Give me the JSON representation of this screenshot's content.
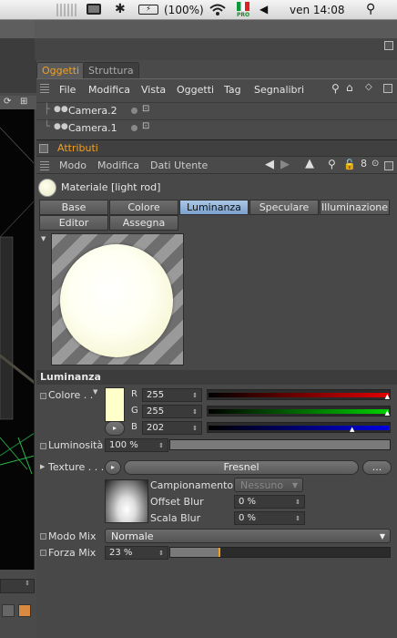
{
  "menubar": {
    "battery": "(100%)",
    "clock": "ven 14:08",
    "flag_label": "PRO"
  },
  "tabs": [
    {
      "label": "Oggetti",
      "active": true
    },
    {
      "label": "Struttura",
      "active": false
    }
  ],
  "object_manager": {
    "menu": [
      "File",
      "Modifica",
      "Vista",
      "Oggetti",
      "Tag",
      "Segnalibri"
    ],
    "objects": [
      "Camera.2",
      "Camera.1"
    ]
  },
  "attributes": {
    "title": "Attributi",
    "toolbar": [
      "Modo",
      "Modifica",
      "Dati Utente"
    ],
    "material_name": "Materiale [light rod]",
    "channel_tabs": [
      "Base",
      "Colore",
      "Luminanza",
      "Speculare",
      "Illuminazione",
      "Editor",
      "Assegna"
    ],
    "selected_channel": "Luminanza",
    "section_title": "Luminanza",
    "color": {
      "label": "Colore . .",
      "r_label": "R",
      "r": "255",
      "g_label": "G",
      "g": "255",
      "b_label": "B",
      "b": "202",
      "swatch": "#ffffca"
    },
    "brightness": {
      "label": "Luminosità",
      "value": "100 %",
      "fraction": 1.0
    },
    "texture": {
      "label": "Texture . . .",
      "shader": "Fresnel",
      "more": "...",
      "sampling_label": "Campionamento",
      "sampling_value": "Nessuno",
      "offset_label": "Offset Blur",
      "offset_value": "0 %",
      "scale_label": "Scala Blur",
      "scale_value": "0 %"
    },
    "mix_mode": {
      "label": "Modo Mix",
      "value": "Normale"
    },
    "mix_strength": {
      "label": "Forza Mix",
      "value": "23 %",
      "fraction": 0.23
    }
  },
  "colors": {
    "accent": "#f0a020",
    "selected_tab": "#8fb3dc"
  }
}
